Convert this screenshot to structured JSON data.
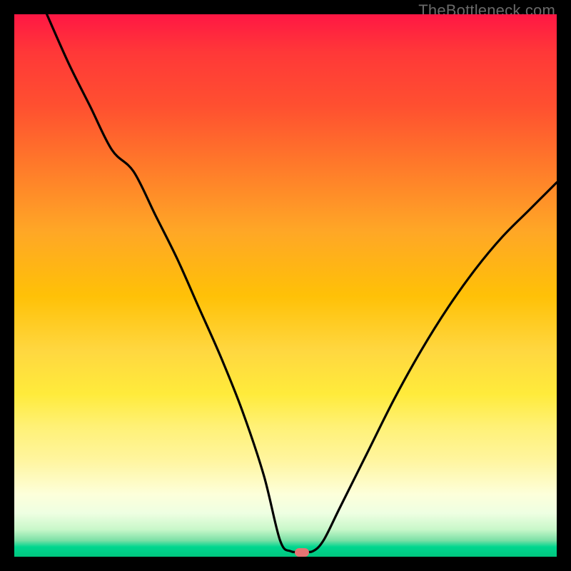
{
  "watermark": "TheBottleneck.com",
  "colors": {
    "curve_stroke": "#000000",
    "marker_fill": "#e57373",
    "bg": "#000000"
  },
  "chart_data": {
    "type": "line",
    "title": "",
    "xlabel": "",
    "ylabel": "",
    "xlim": [
      0,
      100
    ],
    "ylim": [
      0,
      100
    ],
    "grid": false,
    "series": [
      {
        "name": "bottleneck-curve",
        "x": [
          6,
          10,
          14,
          18,
          22,
          26,
          30,
          34,
          38,
          42,
          46,
          49,
          51,
          53,
          55,
          57,
          60,
          65,
          70,
          75,
          80,
          85,
          90,
          95,
          100
        ],
        "y": [
          100,
          91,
          83,
          75,
          71,
          63,
          55,
          46,
          37,
          27,
          15,
          3,
          1,
          1,
          1,
          3,
          9,
          19,
          29,
          38,
          46,
          53,
          59,
          64,
          69
        ]
      }
    ],
    "marker": {
      "x": 53,
      "y": 0.8
    },
    "gradient_note": "Background vertical gradient: red (high bottleneck) at top → green (optimal) at bottom"
  }
}
